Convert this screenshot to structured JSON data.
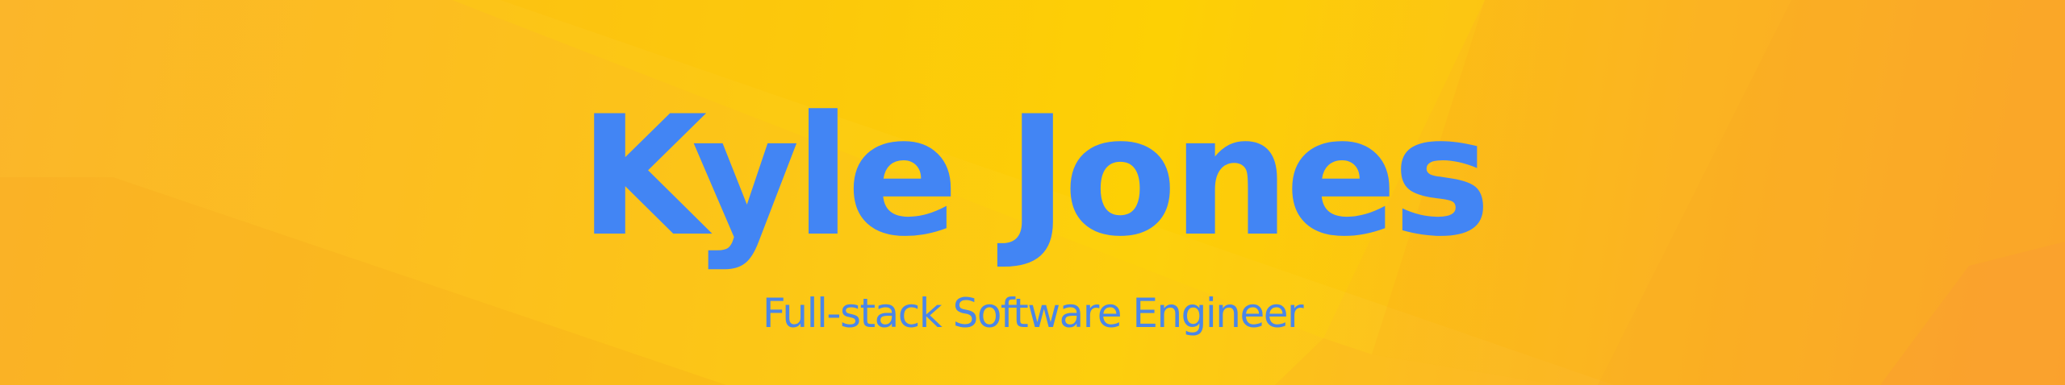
{
  "hero": {
    "name": "Kyle Jones",
    "tagline": "Full-stack Software Engineer"
  },
  "colors": {
    "text_primary": "#4285f4",
    "text_secondary": "#4a86e8",
    "background_yellow": "#fdcd06",
    "background_orange": "#fba62e"
  }
}
